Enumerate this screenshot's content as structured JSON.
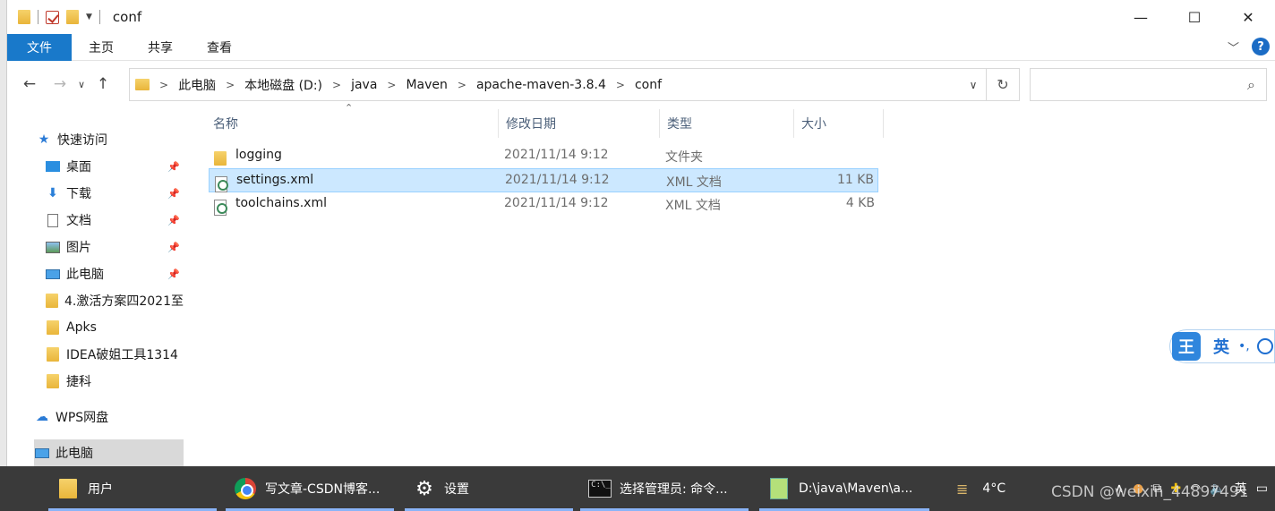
{
  "window": {
    "title": "conf",
    "controls": {
      "minimize": "—",
      "maximize": "☐",
      "close": "✕"
    }
  },
  "ribbon": {
    "tabs": [
      "文件",
      "主页",
      "共享",
      "查看"
    ],
    "help": "?"
  },
  "address": {
    "crumbs": [
      "此电脑",
      "本地磁盘 (D:)",
      "java",
      "Maven",
      "apache-maven-3.8.4",
      "conf"
    ],
    "search_placeholder": ""
  },
  "nav": {
    "quick_access": "快速访问",
    "items": [
      {
        "label": "桌面",
        "icon": "desktop-icon",
        "pinned": true
      },
      {
        "label": "下载",
        "icon": "download-icon",
        "pinned": true
      },
      {
        "label": "文档",
        "icon": "document-icon",
        "pinned": true
      },
      {
        "label": "图片",
        "icon": "picture-icon",
        "pinned": true
      },
      {
        "label": "此电脑",
        "icon": "computer-icon",
        "pinned": true
      },
      {
        "label": "4.激活方案四2021至",
        "icon": "folder-icon",
        "pinned": false
      },
      {
        "label": "Apks",
        "icon": "folder-icon",
        "pinned": false
      },
      {
        "label": "IDEA破姐工具1314",
        "icon": "folder-icon",
        "pinned": false
      },
      {
        "label": "捷科",
        "icon": "folder-icon",
        "pinned": false
      }
    ],
    "wps": "WPS网盘",
    "this_pc": "此电脑"
  },
  "columns": {
    "name": "名称",
    "date": "修改日期",
    "type": "类型",
    "size": "大小"
  },
  "files": [
    {
      "name": "logging",
      "date": "2021/11/14 9:12",
      "type": "文件夹",
      "size": "",
      "icon": "folder-icon",
      "selected": false
    },
    {
      "name": "settings.xml",
      "date": "2021/11/14 9:12",
      "type": "XML 文档",
      "size": "11 KB",
      "icon": "xml-file-icon",
      "selected": true
    },
    {
      "name": "toolchains.xml",
      "date": "2021/11/14 9:12",
      "type": "XML 文档",
      "size": "4 KB",
      "icon": "xml-file-icon",
      "selected": false
    }
  ],
  "ime": {
    "logo": "王",
    "mode": "英",
    "punct": "•,"
  },
  "taskbar": {
    "items": [
      {
        "label": "用户",
        "icon": "folder-icon"
      },
      {
        "label": "写文章-CSDN博客...",
        "icon": "chrome-icon"
      },
      {
        "label": "设置",
        "icon": "gear-icon"
      },
      {
        "label": "选择管理员: 命令...",
        "icon": "cmd-icon"
      },
      {
        "label": "D:\\java\\Maven\\a...",
        "icon": "notepad-icon"
      }
    ],
    "weather": "4°C",
    "ime": "英",
    "watermark": "CSDN @weixin_44897491"
  },
  "colors": {
    "accent": "#1979ca",
    "selection": "#cce8ff",
    "taskbar": "#3a3a3a"
  }
}
